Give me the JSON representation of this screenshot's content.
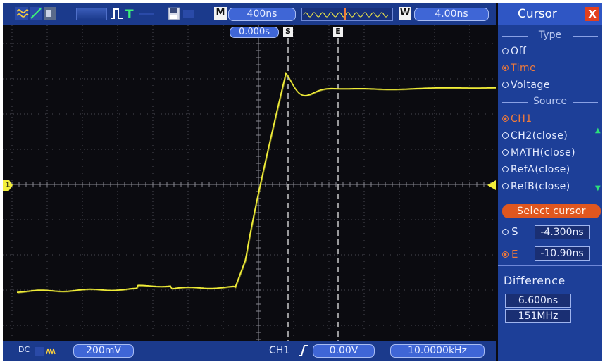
{
  "top_bar": {
    "memory_label": "M",
    "timebase": "400ns",
    "window_label": "W",
    "delay": "4.00ns",
    "trigger_icon": "T"
  },
  "cursor_tag": {
    "time": "0.000s",
    "start_label": "S",
    "end_label": "E"
  },
  "channel_marker": "1",
  "menu": {
    "title": "Cursor",
    "close": "X",
    "type_label": "Type",
    "type_options": [
      "Off",
      "Time",
      "Voltage"
    ],
    "type_selected": "Time",
    "source_label": "Source",
    "source_options": [
      "CH1",
      "CH2(close)",
      "MATH(close)",
      "RefA(close)",
      "RefB(close)"
    ],
    "source_selected": "CH1",
    "select_cursor": "Select cursor",
    "cursor_s_label": "S",
    "cursor_s_value": "-4.300ns",
    "cursor_e_label": "E",
    "cursor_e_value": "-10.90ns",
    "cursor_selected": "E",
    "difference_label": "Difference",
    "difference_time": "6.600ns",
    "difference_freq": "151MHz"
  },
  "bottom_bar": {
    "coupling": "DC",
    "volts_div": "200mV",
    "trigger_source": "CH1",
    "trigger_level": "0.00V",
    "frequency": "10.0000kHz"
  },
  "colors": {
    "trace": "#f2ef3a",
    "panel_blue": "#1d3f98",
    "accent_orange": "#e0571f"
  }
}
